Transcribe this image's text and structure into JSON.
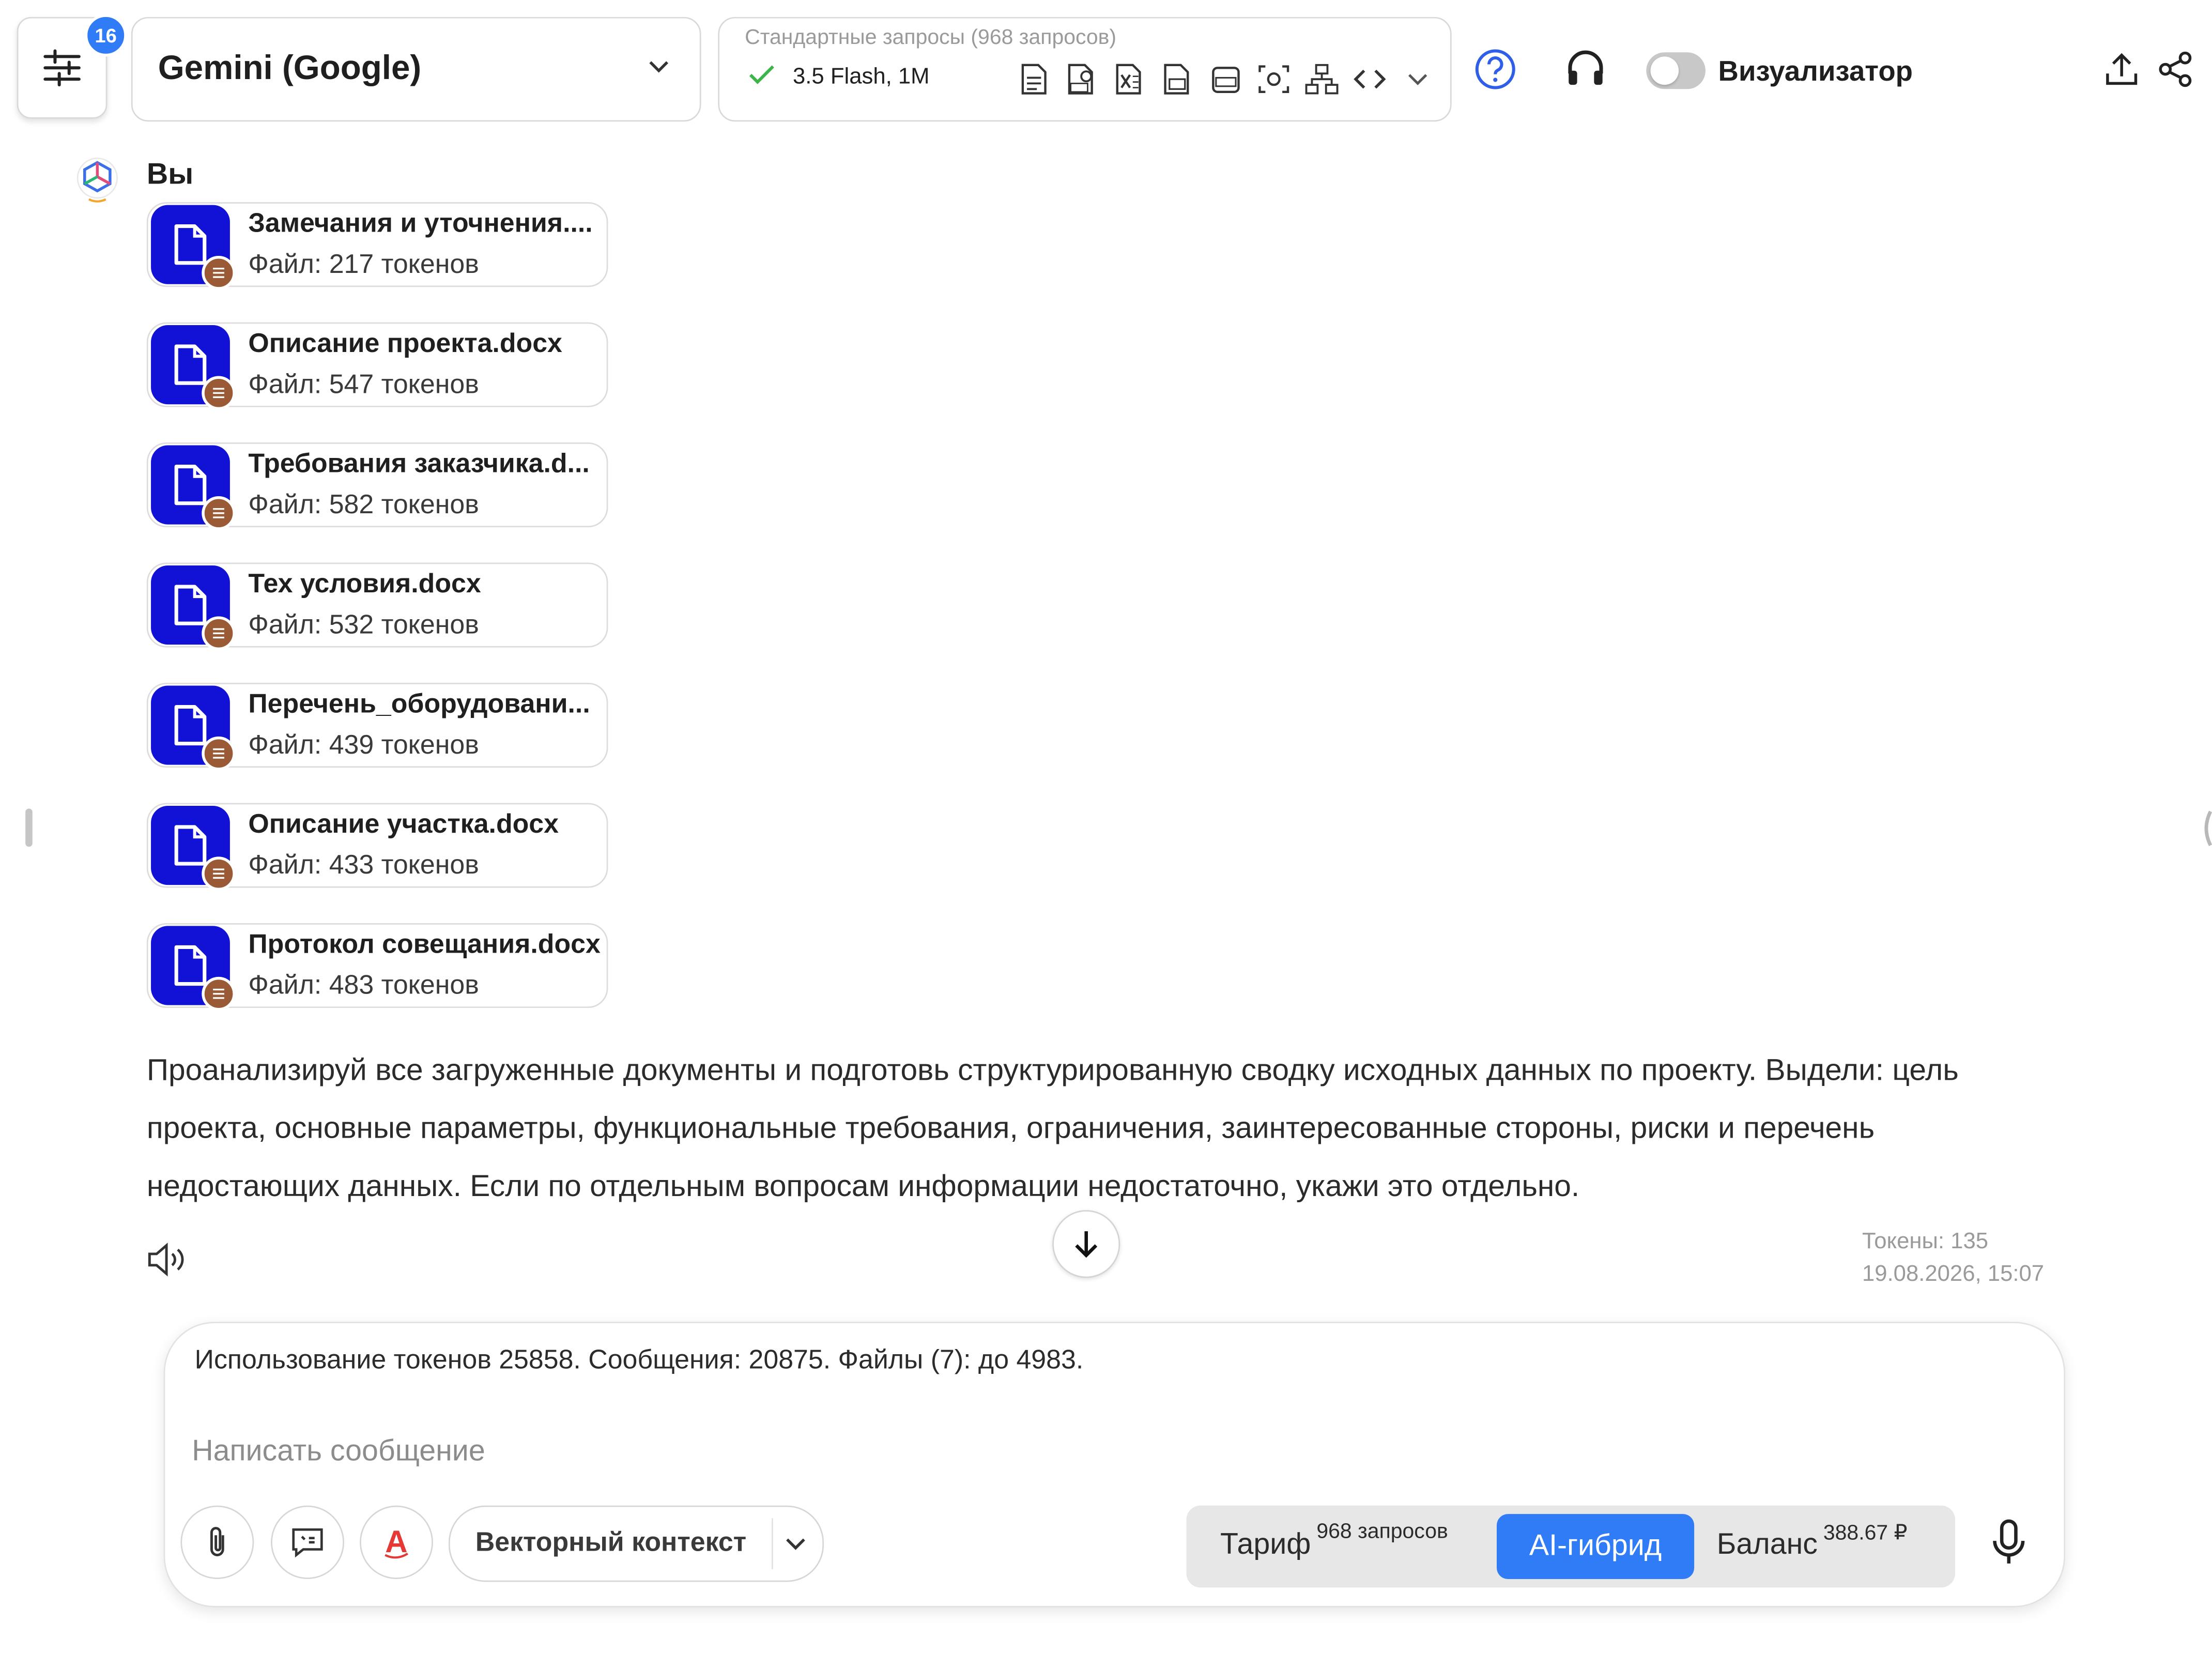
{
  "header": {
    "badge_count": "16",
    "model_name": "Gemini (Google)",
    "requests_title": "Стандартные запросы (968 запросов)",
    "model_variant": "3.5 Flash, 1M",
    "visualizer_label": "Визуализатор",
    "visualizer_on": false,
    "capability_icons": [
      "text-doc-icon",
      "pdf-icon",
      "excel-icon",
      "ppt-doc-icon",
      "docx-doc-icon",
      "image-scan-icon",
      "diagram-icon",
      "code-icon"
    ]
  },
  "message": {
    "sender": "Вы",
    "files": [
      {
        "name": "Замечания и уточнения....",
        "tokens": "Файл: 217 токенов"
      },
      {
        "name": "Описание проекта.docx",
        "tokens": "Файл: 547 токенов"
      },
      {
        "name": "Требования заказчика.d...",
        "tokens": "Файл: 582 токенов"
      },
      {
        "name": "Тех условия.docx",
        "tokens": "Файл: 532 токенов"
      },
      {
        "name": "Перечень_оборудовани...",
        "tokens": "Файл: 439 токенов"
      },
      {
        "name": "Описание участка.docx",
        "tokens": "Файл: 433 токенов"
      },
      {
        "name": "Протокол совещания.docx",
        "tokens": "Файл: 483 токенов"
      }
    ],
    "text": "Проанализируй все загруженные документы и подготовь структурированную сводку исходных данных по проекту. Выдели: цель проекта, основные параметры, функциональные требования, ограничения, заинтересованные стороны, риски и перечень недостающих данных. Если по отдельным вопросам информации недостаточно, укажи это отдельно.",
    "tokens": "Токены: 135",
    "timestamp": "19.08.2026, 15:07"
  },
  "composer": {
    "usage": "Использование токенов 25858. Сообщения: 20875. Файлы (7): до 4983.",
    "placeholder": "Написать сообщение",
    "vector_context": "Векторный контекст",
    "tariff_label": "Тариф",
    "tariff_sup": "968 запросов",
    "hybrid_label": "AI-гибрид",
    "balance_label": "Баланс",
    "balance_sup": "388.67 ₽"
  },
  "colors": {
    "accent": "#2f7cf6",
    "file_icon_bg": "#1212d6",
    "file_badge": "#9a5a35",
    "check_green": "#3bb54a",
    "spell_red": "#e53935"
  }
}
